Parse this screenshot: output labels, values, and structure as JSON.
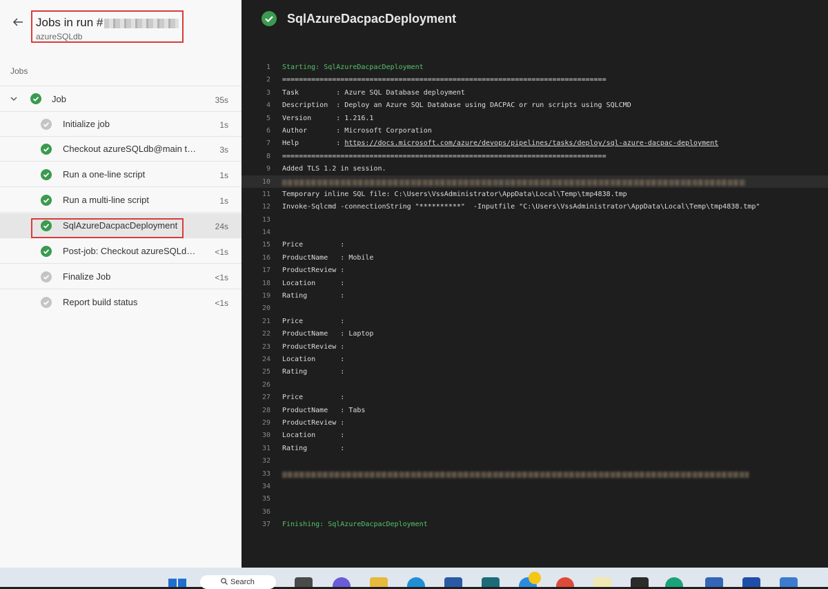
{
  "header": {
    "title_prefix": "Jobs in run #",
    "pipeline_name": "azureSQLdb"
  },
  "jobs_section_label": "Jobs",
  "job_group": {
    "label": "Job",
    "duration": "35s"
  },
  "steps": [
    {
      "label": "Initialize job",
      "duration": "1s",
      "status": "skipped-gray"
    },
    {
      "label": "Checkout azureSQLdb@main to s",
      "duration": "3s",
      "status": "success"
    },
    {
      "label": "Run a one-line script",
      "duration": "1s",
      "status": "success"
    },
    {
      "label": "Run a multi-line script",
      "duration": "1s",
      "status": "success"
    },
    {
      "label": "SqlAzureDacpacDeployment",
      "duration": "24s",
      "status": "success"
    },
    {
      "label": "Post-job: Checkout azureSQLdb…",
      "duration": "<1s",
      "status": "success"
    },
    {
      "label": "Finalize Job",
      "duration": "<1s",
      "status": "skipped-gray"
    },
    {
      "label": "Report build status",
      "duration": "<1s",
      "status": "skipped-gray"
    }
  ],
  "log_header": {
    "title": "SqlAzureDacpacDeployment"
  },
  "log": {
    "l1": "Starting: SqlAzureDacpacDeployment",
    "l2": "==============================================================================",
    "l3": "Task         : Azure SQL Database deployment",
    "l4": "Description  : Deploy an Azure SQL Database using DACPAC or run scripts using SQLCMD",
    "l5": "Version      : 1.216.1",
    "l6": "Author       : Microsoft Corporation",
    "l7_prefix": "Help         : ",
    "l7_link": "https://docs.microsoft.com/azure/devops/pipelines/tasks/deploy/sql-azure-dacpac-deployment",
    "l8": "==============================================================================",
    "l9": "Added TLS 1.2 in session.",
    "l11": "Temporary inline SQL file: C:\\Users\\VssAdministrator\\AppData\\Local\\Temp\\tmp4838.tmp",
    "l12": "Invoke-Sqlcmd -connectionString \"**********\"  -Inputfile \"C:\\Users\\VssAdministrator\\AppData\\Local\\Temp\\tmp4838.tmp\"",
    "l15": "Price         :",
    "l16": "ProductName   : Mobile",
    "l17": "ProductReview :",
    "l18": "Location      :",
    "l19": "Rating        :",
    "l21": "Price         :",
    "l22": "ProductName   : Laptop",
    "l23": "ProductReview :",
    "l24": "Location      :",
    "l25": "Rating        :",
    "l27": "Price         :",
    "l28": "ProductName   : Tabs",
    "l29": "ProductReview :",
    "l30": "Location      :",
    "l31": "Rating        :",
    "l37": "Finishing: SqlAzureDacpacDeployment"
  },
  "line_numbers": [
    "1",
    "2",
    "3",
    "4",
    "5",
    "6",
    "7",
    "8",
    "9",
    "10",
    "11",
    "12",
    "13",
    "14",
    "15",
    "16",
    "17",
    "18",
    "19",
    "20",
    "21",
    "22",
    "23",
    "24",
    "25",
    "26",
    "27",
    "28",
    "29",
    "30",
    "31",
    "32",
    "33",
    "34",
    "35",
    "36",
    "37"
  ],
  "taskbar": {
    "search_text": "Search"
  },
  "colors": {
    "success": "#3b9a4f",
    "gray": "#c4c4c4",
    "highlight_box": "#d93b3b"
  }
}
